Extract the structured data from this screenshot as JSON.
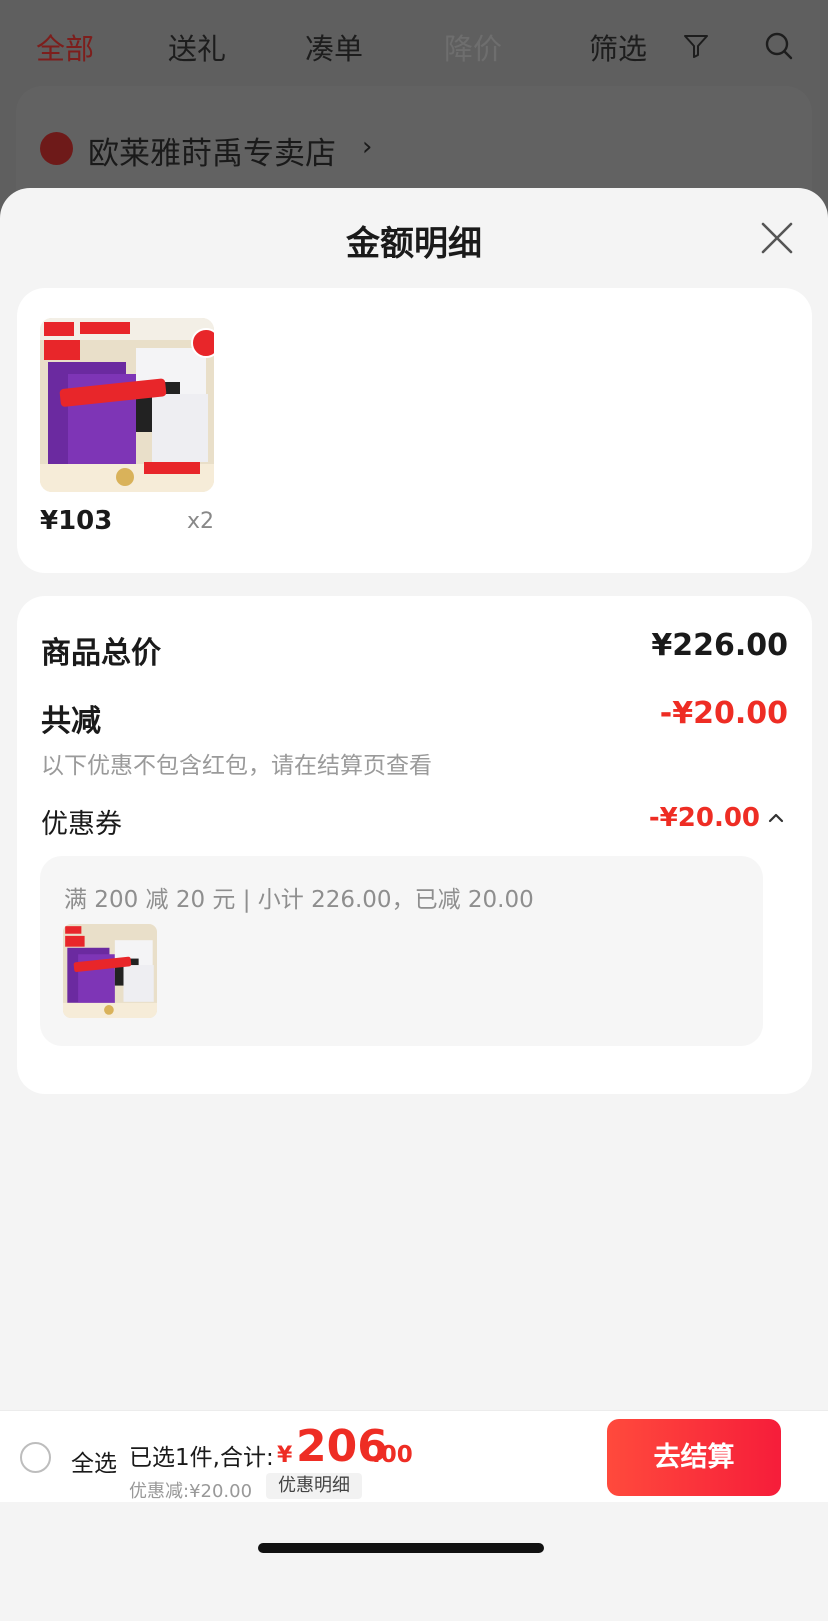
{
  "background_page": {
    "tabs": [
      {
        "label": "全部"
      },
      {
        "label": "送礼"
      },
      {
        "label": "凑单"
      },
      {
        "label": "降价"
      }
    ],
    "filter_label": "筛选",
    "store_name": "欧莱雅莳禹专卖店"
  },
  "sheet": {
    "title": "金额明细"
  },
  "product": {
    "price": "¥103",
    "qty": "x2"
  },
  "summary": {
    "total_label": "商品总价",
    "total_value": "¥226.00",
    "reduce_label": "共减",
    "reduce_value": "-¥20.00",
    "note": "以下优惠不包含红包，请在结算页查看",
    "coupon_label": "优惠券",
    "coupon_value": "-¥20.00",
    "coupon_desc": "满 200 减 20 元 | 小计 226.00，已减 20.00"
  },
  "bottom_bar": {
    "select_all": "全选",
    "selected_text": "已选1件,合计:",
    "currency": "¥",
    "total_int": "206",
    "total_dec": ".00",
    "discount_text": "优惠减:¥20.00",
    "detail_button": "优惠明细",
    "checkout_button": "去结算"
  },
  "colors": {
    "accent_red": "#ee2d24",
    "checkout_gradient_start": "#ff4a3c",
    "checkout_gradient_end": "#f61d3a"
  }
}
